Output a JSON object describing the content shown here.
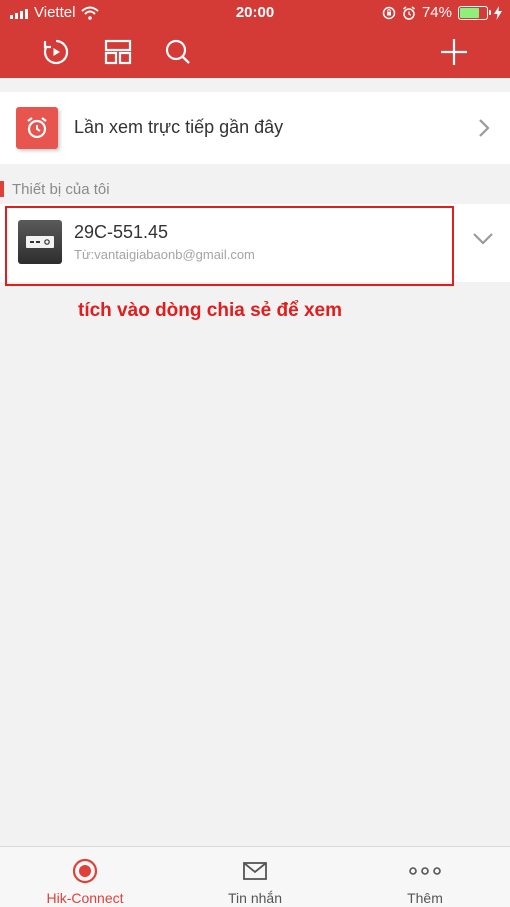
{
  "status_bar": {
    "carrier": "Viettel",
    "time": "20:00",
    "battery_percent": "74%",
    "battery_level": 0.74,
    "icons": [
      "signal-icon",
      "wifi-icon",
      "orientation-lock-icon",
      "alarm-icon",
      "battery-icon",
      "charging-icon"
    ]
  },
  "toolbar": {
    "icons": [
      "history-icon",
      "layout-icon",
      "search-icon",
      "add-icon"
    ]
  },
  "recent": {
    "label": "Lần xem trực tiếp gần đây",
    "icon": "clock-icon"
  },
  "section": {
    "title": "Thiết bị của tôi"
  },
  "device": {
    "name": "29C-551.45",
    "shared_from": "Từ:vantaigiabaonb@gmail.com",
    "icon": "dvr-device-icon"
  },
  "annotation": {
    "instruction": "tích vào dòng chia sẻ để xem"
  },
  "tabs": [
    {
      "label": "Hik-Connect",
      "icon": "hik-connect-icon",
      "active": true
    },
    {
      "label": "Tin nhắn",
      "icon": "mail-icon",
      "active": false
    },
    {
      "label": "Thêm",
      "icon": "more-icon",
      "active": false
    }
  ],
  "colors": {
    "header": "#d43a36",
    "accent": "#e0403a",
    "annotation": "#e11d1d"
  }
}
